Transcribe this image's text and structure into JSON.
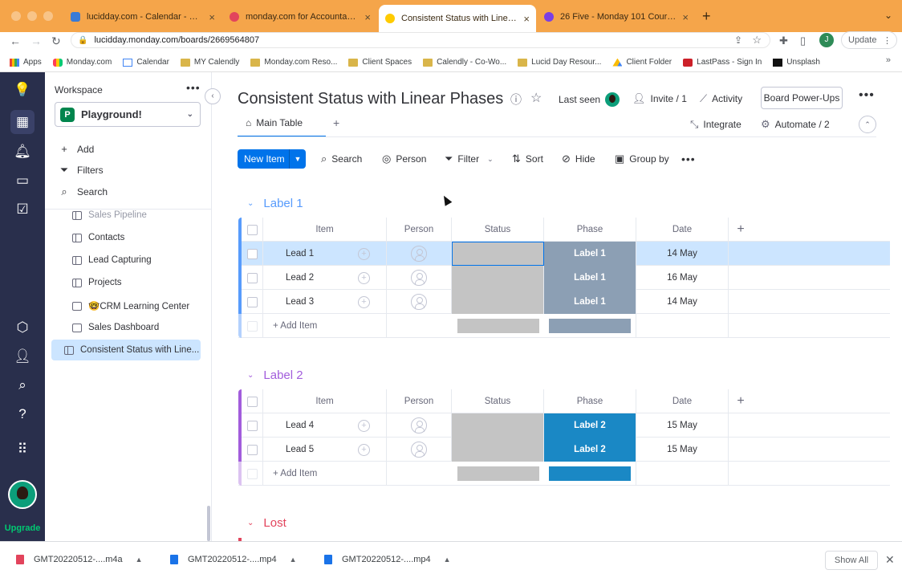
{
  "browser": {
    "tabs": [
      {
        "title": "lucidday.com - Calendar - Wee",
        "icon_color": "#3a7bd5",
        "active": false
      },
      {
        "title": "monday.com for Accountants &",
        "icon_color": "#e2445c",
        "active": false
      },
      {
        "title": "Consistent Status with Linear P",
        "icon_color": "#ffcb00",
        "active": true
      },
      {
        "title": "26 Five - Monday 101 Course",
        "icon_color": "#7b3fe4",
        "active": false
      }
    ],
    "url": "lucidday.monday.com/boards/2669564807",
    "profile_initial": "J",
    "update_label": "Update",
    "bookmarks": [
      {
        "label": "Apps",
        "icon": "apps-grid-icon"
      },
      {
        "label": "Monday.com",
        "icon": "monday-logo-icon"
      },
      {
        "label": "Calendar",
        "icon": "calendar-icon"
      },
      {
        "label": "MY Calendly",
        "icon": "folder-icon"
      },
      {
        "label": "Monday.com Reso...",
        "icon": "folder-icon"
      },
      {
        "label": "Client Spaces",
        "icon": "folder-icon"
      },
      {
        "label": "Calendly - Co-Wo...",
        "icon": "folder-icon"
      },
      {
        "label": "Lucid Day Resour...",
        "icon": "folder-icon"
      },
      {
        "label": "Client Folder",
        "icon": "google-drive-icon"
      },
      {
        "label": "LastPass - Sign In",
        "icon": "lastpass-icon"
      },
      {
        "label": "Unsplash",
        "icon": "unsplash-icon"
      }
    ]
  },
  "rail": {
    "upgrade_label": "Upgrade"
  },
  "workspace": {
    "label": "Workspace",
    "name": "Playground!",
    "badge": "P",
    "actions": {
      "add": "Add",
      "filters": "Filters",
      "search": "Search"
    },
    "items": [
      {
        "label": "Sales Pipeline",
        "icon": "board-icon",
        "faded": true
      },
      {
        "label": "Contacts",
        "icon": "board-icon"
      },
      {
        "label": "Lead Capturing",
        "icon": "board-icon"
      },
      {
        "label": "Projects",
        "icon": "board-icon"
      },
      {
        "label": "🤓CRM Learning Center",
        "icon": "dashboard-icon"
      },
      {
        "label": "Sales Dashboard",
        "icon": "dashboard-icon"
      },
      {
        "label": "Consistent Status with Line...",
        "icon": "board-icon",
        "selected": true
      }
    ]
  },
  "board": {
    "title": "Consistent Status with Linear Phases",
    "last_seen": "Last seen",
    "invite": "Invite / 1",
    "activity": "Activity",
    "power_ups": "Board Power-Ups",
    "main_tab": "Main Table",
    "integrate": "Integrate",
    "automate": "Automate / 2",
    "toolbar": {
      "new_item": "New Item",
      "search": "Search",
      "person": "Person",
      "filter": "Filter",
      "sort": "Sort",
      "hide": "Hide",
      "group_by": "Group by"
    },
    "columns": {
      "item": "Item",
      "person": "Person",
      "status": "Status",
      "phase": "Phase",
      "date": "Date"
    },
    "add_item": "+ Add Item",
    "groups": [
      {
        "title": "Label 1",
        "color": "#579bfc",
        "phase_color": "#8c9fb4",
        "rows": [
          {
            "item": "Lead 1",
            "phase": "Label 1",
            "date": "14 May",
            "selected": true
          },
          {
            "item": "Lead 2",
            "phase": "Label 1",
            "date": "16 May"
          },
          {
            "item": "Lead 3",
            "phase": "Label 1",
            "date": "14 May"
          }
        ]
      },
      {
        "title": "Label 2",
        "color": "#a25ddc",
        "phase_color": "#1a88c5",
        "rows": [
          {
            "item": "Lead 4",
            "phase": "Label 2",
            "date": "15 May"
          },
          {
            "item": "Lead 5",
            "phase": "Label 2",
            "date": "15 May"
          }
        ]
      },
      {
        "title": "Lost",
        "color": "#e2445c",
        "rows": []
      }
    ]
  },
  "downloads": {
    "files": [
      {
        "name": "GMT20220512-....m4a",
        "icon_color": "#e2445c"
      },
      {
        "name": "GMT20220512-....mp4",
        "icon_color": "#1a73e8"
      },
      {
        "name": "GMT20220512-....mp4",
        "icon_color": "#1a73e8"
      }
    ],
    "show_all": "Show All"
  }
}
